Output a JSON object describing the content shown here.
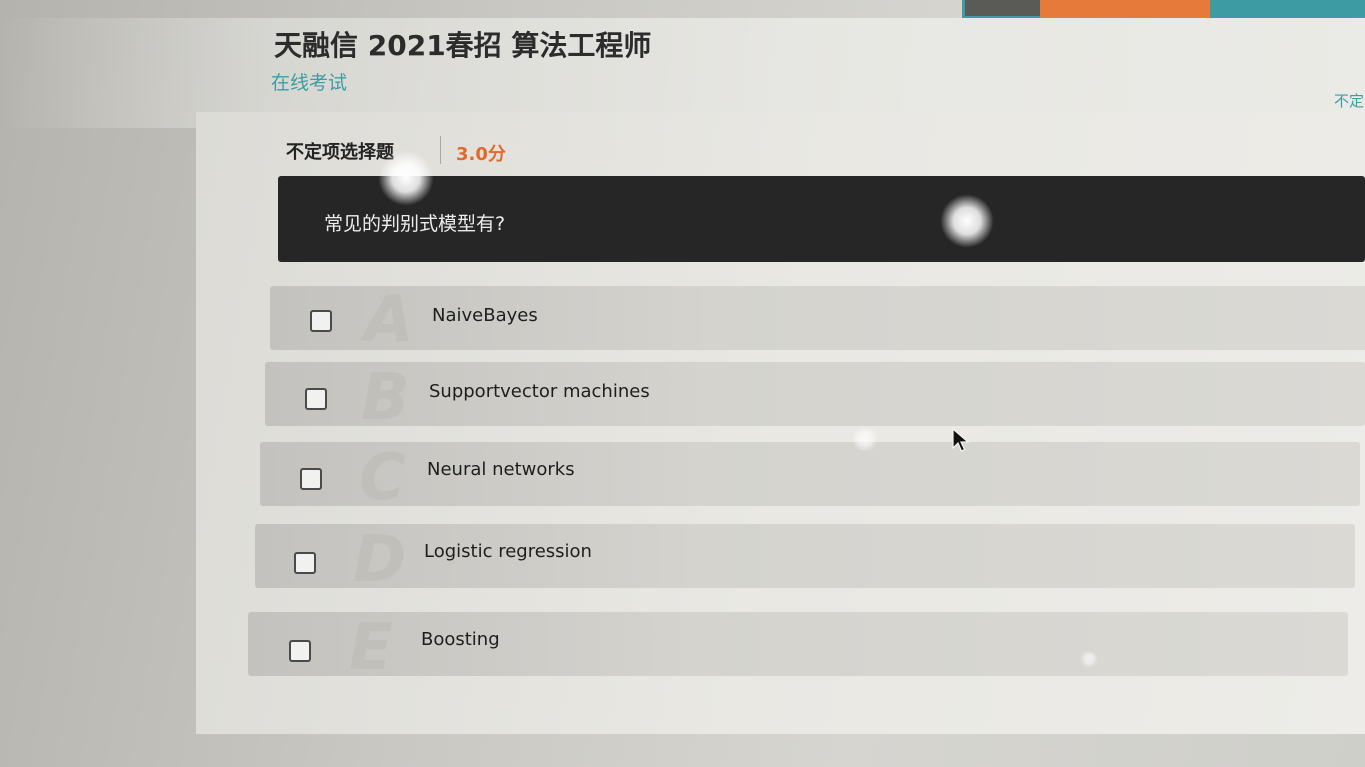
{
  "header": {
    "title": "天融信 2021春招 算法工程师",
    "subtitle": "在线考试",
    "right_tag": "不定"
  },
  "question": {
    "type_label": "不定项选择题",
    "score": "3.0分",
    "text": "常见的判别式模型有?",
    "options": [
      {
        "letter": "A",
        "text": "NaiveBayes",
        "checked": false
      },
      {
        "letter": "B",
        "text": "Supportvector machines",
        "checked": false
      },
      {
        "letter": "C",
        "text": "Neural networks",
        "checked": false
      },
      {
        "letter": "D",
        "text": "Logistic regression",
        "checked": false
      },
      {
        "letter": "E",
        "text": "Boosting",
        "checked": false
      }
    ]
  },
  "colors": {
    "accent": "#3f9ca5",
    "score": "#e06a2e",
    "question_bg": "#262626"
  }
}
